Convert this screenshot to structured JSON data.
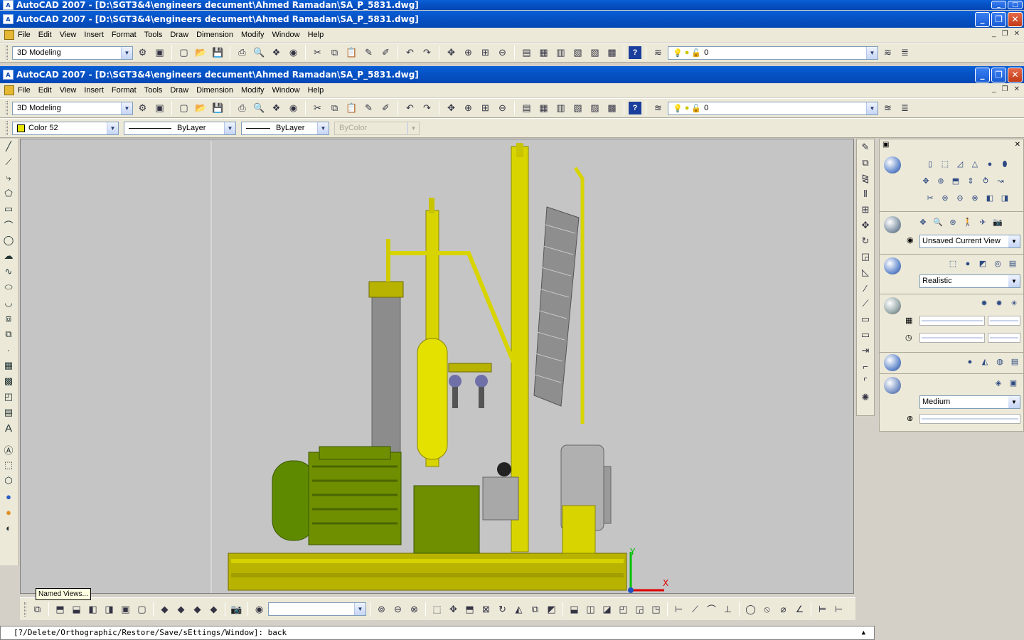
{
  "windows": {
    "back_title": "AutoCAD 2007 - [D:\\SGT3&4\\engineers decument\\Ahmed Ramadan\\SA_P_5831.dwg]",
    "front_title": "AutoCAD 2007 - [D:\\SGT3&4\\engineers decument\\Ahmed Ramadan\\SA_P_5831.dwg]",
    "top_partial_title": "AutoCAD 2007 - [D:\\SGT3&4\\engineers decument\\Ahmed Ramadan\\SA_P_5831.dwg]"
  },
  "menu": [
    "File",
    "Edit",
    "View",
    "Insert",
    "Format",
    "Tools",
    "Draw",
    "Dimension",
    "Modify",
    "Window",
    "Help"
  ],
  "workspace": {
    "value": "3D Modeling"
  },
  "layer": {
    "value": "0"
  },
  "properties": {
    "color": "Color 52",
    "linetype": "ByLayer",
    "lineweight": "ByLayer",
    "plotstyle": "ByColor"
  },
  "dashboard": {
    "view_select": "Unsaved Current View",
    "visual_style": "Realistic",
    "material_quality": "Medium"
  },
  "tooltip": "Named Views...",
  "command_line": "[?/Delete/Orthographic/Restore/Save/sEttings/Window]:  back",
  "ucs": {
    "x": "X",
    "y": "Y"
  },
  "colors": {
    "title_blue": "#0653c6",
    "viewport_bg": "#c5c5c5",
    "model_yellow": "#d8d800",
    "motor_green": "#6f8f00"
  }
}
